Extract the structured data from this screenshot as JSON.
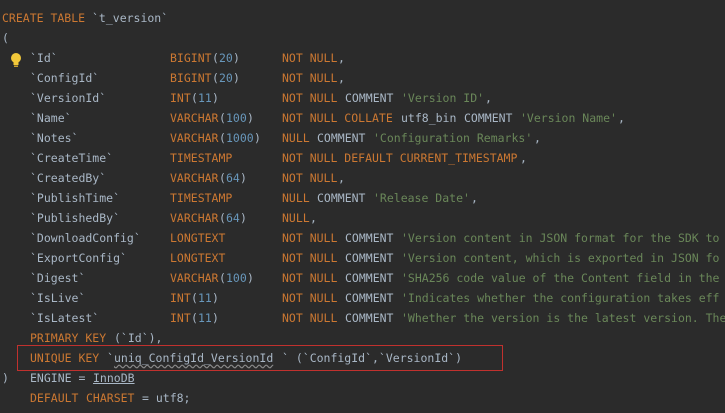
{
  "header": {
    "create_kw": "CREATE TABLE",
    "table_name": "`t_version`",
    "open_paren": "("
  },
  "columns": [
    {
      "name": "`Id`",
      "type_kw": "BIGINT",
      "type_arg": "20",
      "c1_kw": "NOT NULL",
      "c1_pl": "",
      "c2_kw": "",
      "comment_str": "",
      "tail": ","
    },
    {
      "name": "`ConfigId`",
      "type_kw": "BIGINT",
      "type_arg": "20",
      "c1_kw": "NOT NULL",
      "c1_pl": "",
      "c2_kw": "",
      "comment_str": "",
      "tail": ","
    },
    {
      "name": "`VersionId`",
      "type_kw": "INT",
      "type_arg": "11",
      "c1_kw": "NOT NULL",
      "c1_pl": "",
      "c2_kw": "COMMENT",
      "comment_str": "'Version ID'",
      "tail": ","
    },
    {
      "name": "`Name`",
      "type_kw": "VARCHAR",
      "type_arg": "100",
      "c1_kw": "NOT NULL COLLATE",
      "c1_pl": "utf8_bin",
      "c2_kw": "COMMENT",
      "comment_str": "'Version Name'",
      "tail": ","
    },
    {
      "name": "`Notes`",
      "type_kw": "VARCHAR",
      "type_arg": "1000",
      "c1_kw": "NULL",
      "c1_pl": "",
      "c2_kw": "COMMENT",
      "comment_str": "'Configuration Remarks'",
      "tail": ","
    },
    {
      "name": "`CreateTime`",
      "type_kw": "TIMESTAMP",
      "type_arg": "",
      "c1_kw": "NOT NULL DEFAULT CURRENT_TIMESTAMP",
      "c1_pl": "",
      "c2_kw": "",
      "comment_str": "",
      "tail": ","
    },
    {
      "name": "`CreatedBy`",
      "type_kw": "VARCHAR",
      "type_arg": "64",
      "c1_kw": "NOT NULL",
      "c1_pl": "",
      "c2_kw": "",
      "comment_str": "",
      "tail": ","
    },
    {
      "name": "`PublishTime`",
      "type_kw": "TIMESTAMP",
      "type_arg": "",
      "c1_kw": "NULL",
      "c1_pl": "",
      "c2_kw": "COMMENT",
      "comment_str": "'Release Date'",
      "tail": ","
    },
    {
      "name": "`PublishedBy`",
      "type_kw": "VARCHAR",
      "type_arg": "64",
      "c1_kw": "NULL",
      "c1_pl": "",
      "c2_kw": "",
      "comment_str": "",
      "tail": ","
    },
    {
      "name": "`DownloadConfig`",
      "type_kw": "LONGTEXT",
      "type_arg": "",
      "c1_kw": "NOT NULL",
      "c1_pl": "",
      "c2_kw": "COMMENT",
      "comment_str": "'Version content in JSON format for the SDK to",
      "tail": ""
    },
    {
      "name": "`ExportConfig`",
      "type_kw": "LONGTEXT",
      "type_arg": "",
      "c1_kw": "NOT NULL",
      "c1_pl": "",
      "c2_kw": "COMMENT",
      "comment_str": "'Version content, which is exported in JSON fo",
      "tail": ""
    },
    {
      "name": "`Digest`",
      "type_kw": "VARCHAR",
      "type_arg": "100",
      "c1_kw": "NOT NULL",
      "c1_pl": "",
      "c2_kw": "COMMENT",
      "comment_str": "'SHA256 code value of the Content field in the",
      "tail": ""
    },
    {
      "name": "`IsLive`",
      "type_kw": "INT",
      "type_arg": "11",
      "c1_kw": "NOT NULL",
      "c1_pl": "",
      "c2_kw": "COMMENT",
      "comment_str": "'Indicates whether the configuration takes eff",
      "tail": ""
    },
    {
      "name": "`IsLatest`",
      "type_kw": "INT",
      "type_arg": "11",
      "c1_kw": "NOT NULL",
      "c1_pl": "",
      "c2_kw": "COMMENT",
      "comment_str": "'Whether the version is the latest version. The",
      "tail": ""
    }
  ],
  "primary_key": {
    "kw": "PRIMARY KEY",
    "rest": "(`Id`),"
  },
  "unique_key": {
    "kw": "UNIQUE KEY",
    "tick_open": "`",
    "name": "uniq_ConfigId_VersionId",
    "rest": "` (`ConfigId`,`VersionId`)"
  },
  "footer": {
    "close_paren": ")",
    "engine_label": "ENGINE =",
    "engine_value": "InnoDB",
    "default_kw": "DEFAULT",
    "charset_kw": "CHARSET",
    "charset_rest": "= utf8;"
  },
  "colors": {
    "keyword": "#cc7832",
    "string": "#6a8759",
    "number": "#6897bb",
    "plain": "#a9b7c6",
    "highlight": "#c0312e",
    "background": "#2b2b2b"
  },
  "icons": {
    "intention": "lightbulb-icon"
  }
}
